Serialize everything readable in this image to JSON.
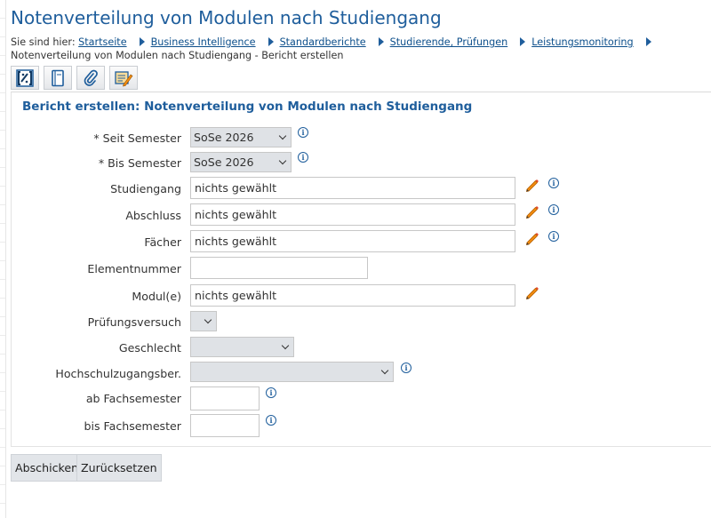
{
  "page": {
    "title": "Notenverteilung von Modulen nach Studiengang"
  },
  "breadcrumb": {
    "prefix": "Sie sind hier:",
    "links": [
      "Startseite",
      "Business Intelligence",
      "Standardberichte",
      "Studierende, Prüfungen",
      "Leistungsmonitoring"
    ],
    "current": "Notenverteilung von Modulen nach Studiengang - Bericht erstellen"
  },
  "toolbar": {
    "buttons": [
      {
        "icon": "report-fields-icon"
      },
      {
        "icon": "notebook-icon"
      },
      {
        "icon": "paperclip-icon"
      },
      {
        "icon": "edit-document-icon"
      }
    ]
  },
  "form": {
    "heading": "Bericht erstellen: Notenverteilung von Modulen nach Studiengang",
    "info_glyph": "i",
    "fields": {
      "seit_semester": {
        "label": "* Seit Semester",
        "value": "SoSe 2026"
      },
      "bis_semester": {
        "label": "* Bis Semester",
        "value": "SoSe 2026"
      },
      "studiengang": {
        "label": "Studiengang",
        "value": "nichts gewählt"
      },
      "abschluss": {
        "label": "Abschluss",
        "value": "nichts gewählt"
      },
      "faecher": {
        "label": "Fächer",
        "value": "nichts gewählt"
      },
      "elementnummer": {
        "label": "Elementnummer",
        "value": ""
      },
      "module": {
        "label": "Modul(e)",
        "value": "nichts gewählt"
      },
      "pruefungsversuch": {
        "label": "Prüfungsversuch",
        "value": ""
      },
      "geschlecht": {
        "label": "Geschlecht",
        "value": ""
      },
      "hzb": {
        "label": "Hochschulzugangsber.",
        "value": ""
      },
      "ab_fachsemester": {
        "label": "ab Fachsemester",
        "value": ""
      },
      "bis_fachsemester": {
        "label": "bis Fachsemester",
        "value": ""
      }
    }
  },
  "actions": {
    "submit": "Abschicken",
    "reset": "Zurücksetzen"
  },
  "colors": {
    "accent": "#1f5e9c",
    "link": "#0d4f8b",
    "pencil": "#f28c0f"
  }
}
